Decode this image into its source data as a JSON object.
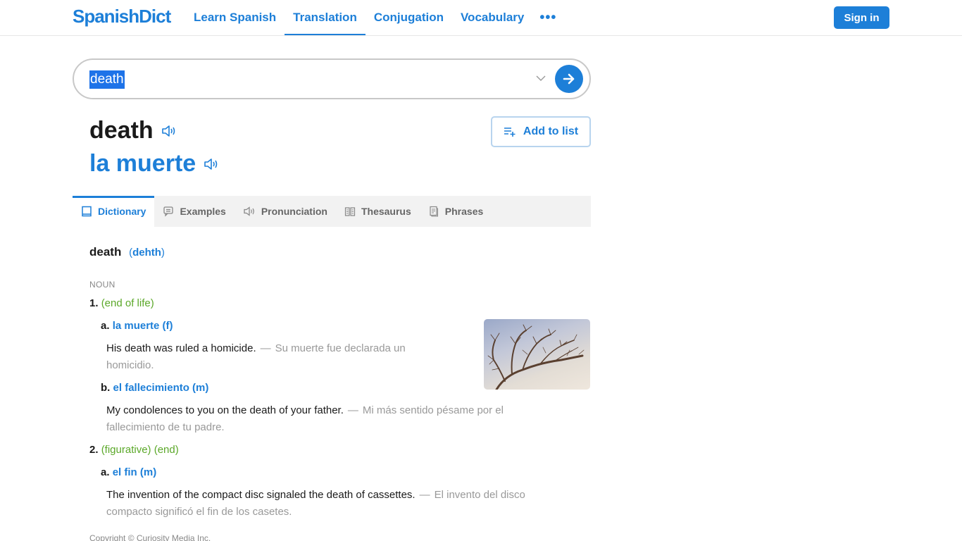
{
  "header": {
    "logo": "SpanishDict",
    "nav": [
      {
        "label": "Learn Spanish",
        "active": false
      },
      {
        "label": "Translation",
        "active": true
      },
      {
        "label": "Conjugation",
        "active": false
      },
      {
        "label": "Vocabulary",
        "active": false
      }
    ],
    "more_label": "•••",
    "sign_in_label": "Sign in"
  },
  "search": {
    "value": "death",
    "chevron_icon": "chevron-down-icon",
    "go_icon": "arrow-right-icon"
  },
  "quickdef": {
    "headword": "death",
    "translation": "la muerte",
    "add_to_list_label": "Add to list"
  },
  "tabs": [
    {
      "label": "Dictionary",
      "icon": "book-icon",
      "active": true
    },
    {
      "label": "Examples",
      "icon": "chat-bubble-icon",
      "active": false
    },
    {
      "label": "Pronunciation",
      "icon": "speaker-icon",
      "active": false
    },
    {
      "label": "Thesaurus",
      "icon": "open-book-icon",
      "active": false
    },
    {
      "label": "Phrases",
      "icon": "document-icon",
      "active": false
    }
  ],
  "dictionary": {
    "word": "death",
    "pronunciation": "dehth",
    "pos": "NOUN",
    "senses": [
      {
        "num": "1.",
        "context": "(end of life)",
        "translations": [
          {
            "letter": "a.",
            "text": "la muerte (f)",
            "example_en": "His death was ruled a homicide.",
            "example_es": "Su muerte fue declarada un homicidio."
          },
          {
            "letter": "b.",
            "text": "el fallecimiento (m)",
            "example_en": "My condolences to you on the death of your father.",
            "example_es": "Mi más sentido pésame por el fallecimiento de tu padre."
          }
        ]
      },
      {
        "num": "2.",
        "context": "(figurative) (end)",
        "translations": [
          {
            "letter": "a.",
            "text": "el fin (m)",
            "example_en": "The invention of the compact disc signaled the death of cassettes.",
            "example_es": "El invento del disco compacto significó el fin de los casetes."
          }
        ]
      }
    ],
    "image_alt": "bare tree against sky"
  },
  "footer": {
    "copyright": "Copyright © Curiosity Media Inc."
  },
  "colors": {
    "brand": "#1d7fd8",
    "context_green": "#5ba829",
    "muted": "#999999"
  }
}
